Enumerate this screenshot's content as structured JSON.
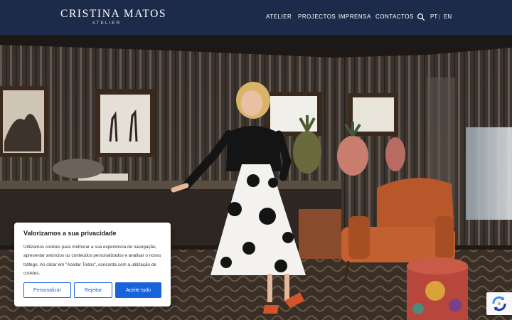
{
  "brand": {
    "name": "CRISTINA MATOS",
    "subtitle": "ATELIER"
  },
  "nav": {
    "items": [
      "ATELIER",
      "PROJECTOS",
      "IMPRENSA",
      "CONTACTOS"
    ]
  },
  "search": {
    "icon": "search-icon"
  },
  "language": {
    "pt": "PT",
    "separator": "|",
    "en": "EN"
  },
  "hero": {
    "description": "Woman in black top and white floral skirt posing in a mirrored room with framed safari prints, pineapple sculptures and an orange armchair"
  },
  "cookie": {
    "title": "Valorizamos a sua privacidade",
    "text": "Utilizamos cookies para melhorar a sua experiência de navegação, apresentar anúncios ou conteúdos personalizados e analisar o nosso tráfego. Ao clicar em \"Aceitar Todos\", concorda com a utilização de cookies.",
    "customize": "Personalizar",
    "reject": "Rejeitar",
    "accept": "Aceite tudo"
  },
  "colors": {
    "header": "#1d2b4a",
    "accent": "#1863dc"
  }
}
